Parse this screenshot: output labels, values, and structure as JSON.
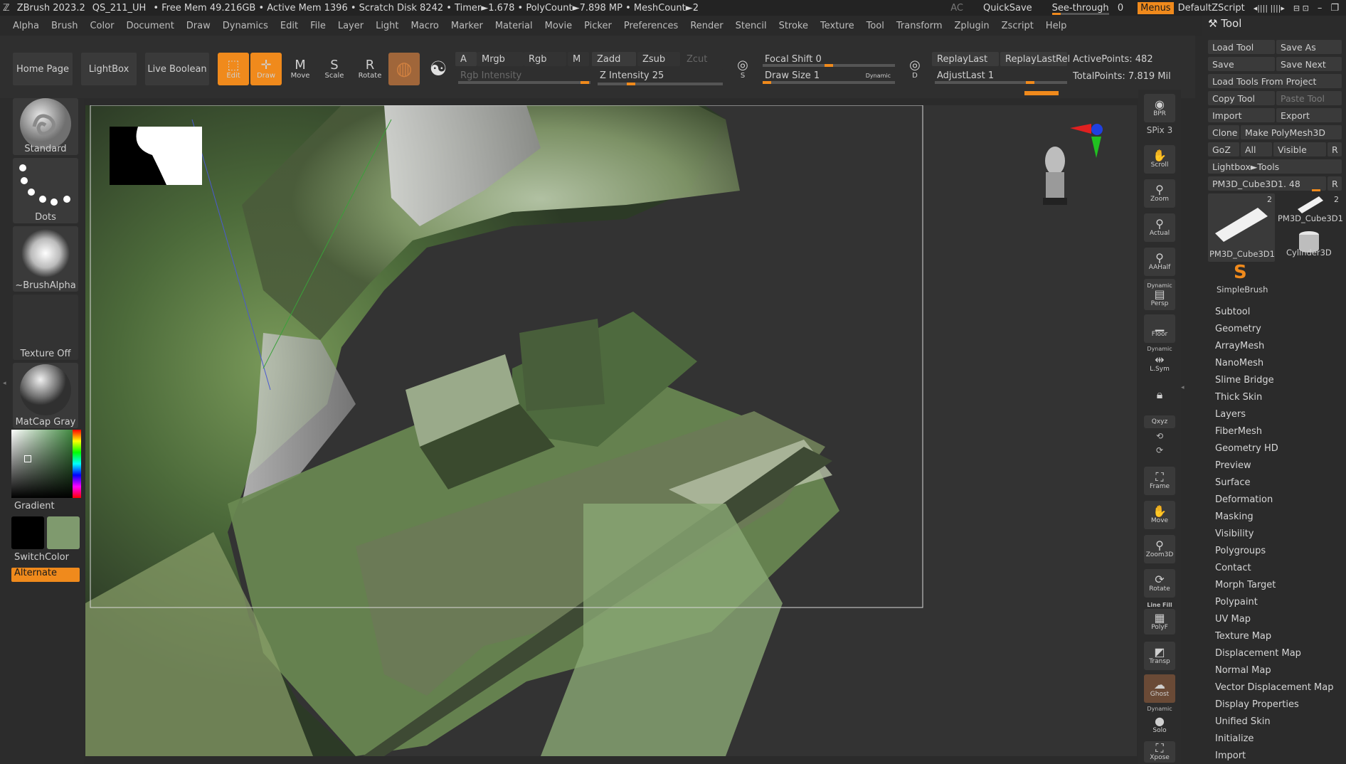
{
  "titlebar": {
    "app": "ZBrush 2023.2",
    "doc": "QS_211_UH",
    "stats": "• Free Mem 49.216GB • Active Mem 1396 • Scratch Disk 8242 • Timer►1.678 • PolyCount►7.898 MP • MeshCount►2",
    "ac": "AC",
    "quicksave": "QuickSave",
    "see_through": "See-through",
    "see_through_value": "0",
    "menus": "Menus",
    "script": "DefaultZScript"
  },
  "menubar": [
    "Alpha",
    "Brush",
    "Color",
    "Document",
    "Draw",
    "Dynamics",
    "Edit",
    "File",
    "Layer",
    "Light",
    "Macro",
    "Marker",
    "Material",
    "Movie",
    "Picker",
    "Preferences",
    "Render",
    "Stencil",
    "Stroke",
    "Texture",
    "Tool",
    "Transform",
    "Zplugin",
    "Zscript",
    "Help"
  ],
  "toolbar": {
    "home_page": "Home Page",
    "lightbox": "LightBox",
    "live_boolean": "Live Boolean",
    "edit": "Edit",
    "draw": "Draw",
    "move": "Move",
    "scale": "Scale",
    "rotate": "Rotate",
    "a": "A",
    "mrgb": "Mrgb",
    "rgb": "Rgb",
    "m": "M",
    "zadd": "Zadd",
    "zsub": "Zsub",
    "zcut": "Zcut",
    "rgb_intensity": "Rgb Intensity",
    "z_intensity": "Z Intensity 25",
    "focal_shift": "Focal Shift 0",
    "draw_size": "Draw Size 1",
    "dynamic": "Dynamic",
    "replay_last": "ReplayLast",
    "replay_last_rel": "ReplayLastRel",
    "adjust_last": "AdjustLast 1",
    "active_points": "ActivePoints: 482",
    "total_points": "TotalPoints: 7.819 Mil",
    "z_intensity_level": 0.25,
    "focal_shift_level": 0.5
  },
  "leftshelf": {
    "brush": "Standard",
    "stroke": "Dots",
    "alpha": "~BrushAlpha",
    "texture": "Texture Off",
    "material": "MatCap Gray",
    "gradient": "Gradient",
    "switch_color": "SwitchColor",
    "alternate": "Alternate",
    "main_color": "#000000",
    "secondary_color": "#7f9a6e"
  },
  "rightshelf": {
    "bpr": "BPR",
    "spix": "SPix 3",
    "scroll": "Scroll",
    "zoom": "Zoom",
    "actual": "Actual",
    "aahalf": "AAHalf",
    "dynamic_persp": "Dynamic",
    "persp": "Persp",
    "floor": "Floor",
    "dynamic_lsym": "Dynamic",
    "lsym": "L.Sym",
    "xyz": "Qxyz",
    "frame": "Frame",
    "move": "Move",
    "zoom3d": "Zoom3D",
    "rotate": "Rotate",
    "line_fill": "Line Fill",
    "polyf": "PolyF",
    "transp": "Transp",
    "ghost": "Ghost",
    "dynamic_solo": "Dynamic",
    "solo": "Solo",
    "xpose": "Xpose"
  },
  "tool": {
    "title": "Tool",
    "load_tool": "Load Tool",
    "save_as": "Save As",
    "save": "Save",
    "save_next": "Save Next",
    "load_from_project": "Load Tools From Project",
    "copy_tool": "Copy Tool",
    "paste_tool": "Paste Tool",
    "import": "Import",
    "export": "Export",
    "clone": "Clone",
    "make_polymesh": "Make PolyMesh3D",
    "goz": "GoZ",
    "all": "All",
    "visible": "Visible",
    "r": "R",
    "lightbox_tools": "Lightbox►Tools",
    "current_tool": "PM3D_Cube3D1. 48",
    "thumbs": [
      {
        "label": "PM3D_Cube3D1",
        "count": "2"
      },
      {
        "label": "PM3D_Cube3D1",
        "count": "2"
      },
      {
        "label": "Cylinder3D",
        "count": ""
      },
      {
        "label": "SimpleBrush",
        "count": ""
      }
    ],
    "subpalettes": [
      "Subtool",
      "Geometry",
      "ArrayMesh",
      "NanoMesh",
      "Slime Bridge",
      "Thick Skin",
      "Layers",
      "FiberMesh",
      "Geometry HD",
      "Preview",
      "Surface",
      "Deformation",
      "Masking",
      "Visibility",
      "Polygroups",
      "Contact",
      "Morph Target",
      "Polypaint",
      "UV Map",
      "Texture Map",
      "Displacement Map",
      "Normal Map",
      "Vector Displacement Map",
      "Display Properties",
      "Unified Skin",
      "Initialize",
      "Import"
    ]
  },
  "colors": {
    "accent": "#f08a1c",
    "panel": "#2f2f2f",
    "button": "#3a3a3a"
  }
}
